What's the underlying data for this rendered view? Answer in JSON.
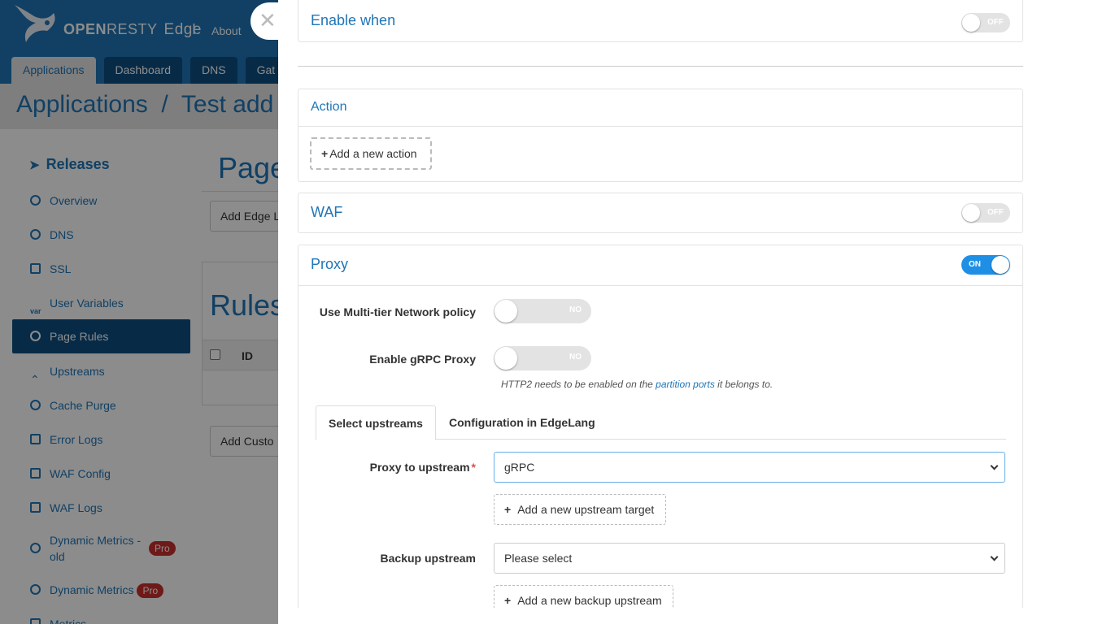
{
  "background": {
    "brand": {
      "open": "OPEN",
      "resty": "RESTY",
      "edge": "Edge"
    },
    "brand_sep": "I",
    "about": "About",
    "tabs": [
      "Applications",
      "Dashboard",
      "DNS",
      "Gat"
    ],
    "breadcrumb": "Applications  /  Test add",
    "sidebar": {
      "heading": "Releases",
      "items": [
        {
          "label": "Overview",
          "icon": "gauge-icon"
        },
        {
          "label": "DNS",
          "icon": "globe-icon"
        },
        {
          "label": "SSL",
          "icon": "certificate-icon"
        },
        {
          "label": "User Variables",
          "icon": "var-icon"
        },
        {
          "label": "Page Rules",
          "icon": "arrow-circle-icon"
        },
        {
          "label": "Upstreams",
          "icon": "chevron-up-icon"
        },
        {
          "label": "Cache Purge",
          "icon": "cache-icon"
        },
        {
          "label": "Error Logs",
          "icon": "log-icon"
        },
        {
          "label": "WAF Config",
          "icon": "list-icon"
        },
        {
          "label": "WAF Logs",
          "icon": "waf-log-icon"
        },
        {
          "label": "Dynamic Metrics - old",
          "icon": "map-pin-icon",
          "badge": "Pro"
        },
        {
          "label": "Dynamic Metrics",
          "icon": "map-pin-icon",
          "badge": "Pro"
        },
        {
          "label": "Metrics",
          "icon": "chart-icon"
        }
      ]
    },
    "main": {
      "title": "Page",
      "add_edge_btn": "Add Edge L",
      "rules_title": "Rules",
      "rules_id_header": "ID",
      "add_custom_btn": "Add Custo"
    }
  },
  "drawer": {
    "enable_when": {
      "title": "Enable when",
      "toggle": "OFF"
    },
    "action": {
      "title": "Action",
      "add_button": "Add a new action"
    },
    "waf": {
      "title": "WAF",
      "toggle": "OFF"
    },
    "proxy": {
      "title": "Proxy",
      "toggle": "ON",
      "multi_tier_label": "Use Multi-tier Network policy",
      "multi_tier_toggle": "NO",
      "grpc_label": "Enable gRPC Proxy",
      "grpc_toggle": "NO",
      "hint_before": "HTTP2 needs to be enabled on the ",
      "hint_link": "partition ports",
      "hint_after": " it belongs to.",
      "tabs": [
        "Select upstreams",
        "Configuration in EdgeLang"
      ],
      "upstream_label": "Proxy to upstream",
      "upstream_value": "gRPC",
      "add_upstream_btn": "Add a new upstream target",
      "backup_label": "Backup upstream",
      "backup_value": "Please select",
      "add_backup_btn": "Add a new backup upstream"
    }
  },
  "colors": {
    "primary": "#1f75b6",
    "nav_dark": "#0d4f82",
    "toggle_on": "#1f8fe6",
    "pro_badge": "#c9302c"
  }
}
